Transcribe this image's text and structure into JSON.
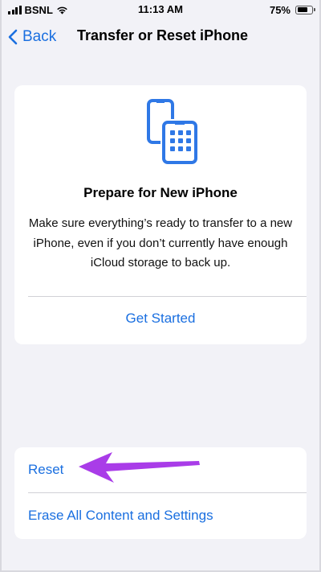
{
  "status_bar": {
    "carrier": "BSNL",
    "time": "11:13 AM",
    "battery_text": "75%",
    "battery_level": 0.75,
    "icons": [
      "signal-icon",
      "wifi-icon",
      "battery-icon"
    ]
  },
  "nav": {
    "back_label": "Back",
    "title": "Transfer or Reset iPhone"
  },
  "prepare_card": {
    "icon": "two-phones-icon",
    "title": "Prepare for New iPhone",
    "description": "Make sure everything’s ready to transfer to a new iPhone, even if you don’t currently have enough iCloud storage to back up.",
    "action_label": "Get Started"
  },
  "reset_card": {
    "items": [
      {
        "label": "Reset"
      },
      {
        "label": "Erase All Content and Settings"
      }
    ]
  },
  "colors": {
    "accent": "#1a6fe0",
    "background": "#f2f2f7",
    "card": "#ffffff",
    "annotation_arrow": "#a93ce8"
  }
}
